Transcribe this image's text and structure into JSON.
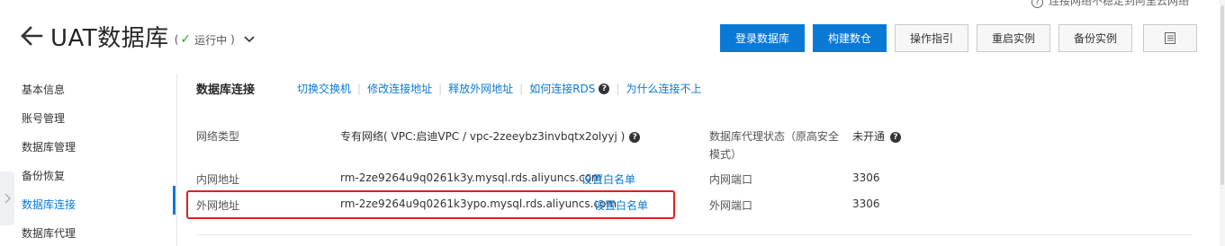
{
  "top_note": "连接网络不稳定到阿里云网络",
  "header": {
    "title": "UAT数据库",
    "status_text": "运行中",
    "paren_open": "(",
    "paren_close": ")"
  },
  "actions": {
    "login_db": "登录数据库",
    "build_warehouse": "构建数仓",
    "guide": "操作指引",
    "restart": "重启实例",
    "backup": "备份实例"
  },
  "sidebar": {
    "items": [
      {
        "label": "基本信息"
      },
      {
        "label": "账号管理"
      },
      {
        "label": "数据库管理"
      },
      {
        "label": "备份恢复"
      },
      {
        "label": "数据库连接"
      },
      {
        "label": "数据库代理"
      }
    ]
  },
  "main": {
    "section_title": "数据库连接",
    "links": {
      "switch": "切换交换机",
      "modify": "修改连接地址",
      "release": "释放外网地址",
      "how_to_connect": "如何连接RDS",
      "why_fail": "为什么连接不上"
    },
    "network_type_label": "网络类型",
    "network_type_value": "专有网络( VPC:启迪VPC / vpc-2zeeybz3invbqtx2olyyj )",
    "proxy_status_label_1": "数据库代理状态（原高安全",
    "proxy_status_label_2": "模式）",
    "proxy_status_value": "未开通",
    "intranet_label": "内网地址",
    "intranet_value": "rm-2ze9264u9q0261k3y.mysql.rds.aliyuncs.com",
    "whitelist_label": "设置白名单",
    "intranet_port_label": "内网端口",
    "intranet_port_value": "3306",
    "public_label": "外网地址",
    "public_value": "rm-2ze9264u9q0261k3ypo.mysql.rds.aliyuncs.com",
    "public_port_label": "外网端口",
    "public_port_value": "3306"
  },
  "colors": {
    "primary": "#0a79d6",
    "success": "#21a830",
    "highlight": "#e0201e"
  }
}
